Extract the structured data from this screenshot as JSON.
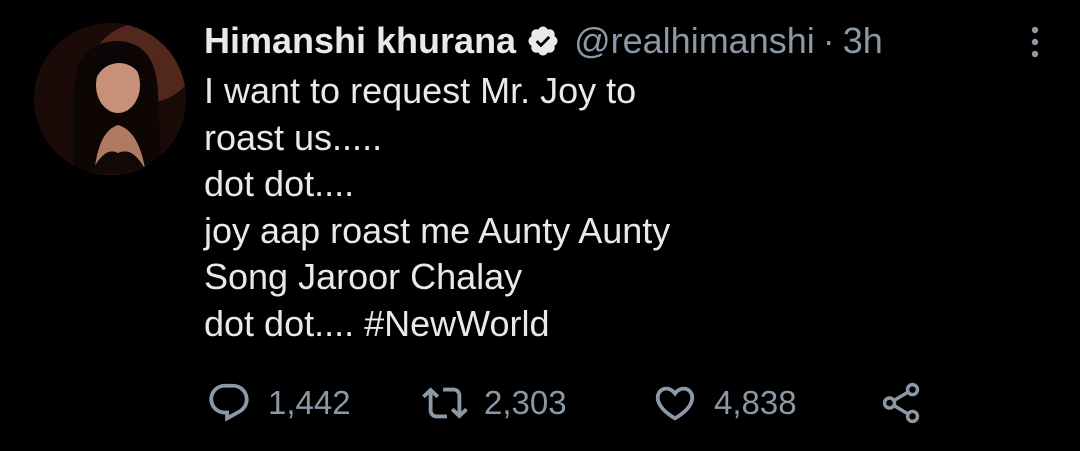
{
  "tweet": {
    "author": {
      "name": "Himanshi khurana",
      "handle": "@realhimanshi",
      "verified": true
    },
    "separator": "·",
    "time": "3h",
    "lines": [
      "I want to request Mr. Joy to",
      "roast us.....",
      "dot dot....",
      "joy aap roast me Aunty Aunty",
      "Song Jaroor Chalay"
    ],
    "last_line_prefix": "dot dot....",
    "hashtag": "#NewWorld",
    "stats": {
      "replies": "1,442",
      "retweets": "2,303",
      "likes": "4,838"
    },
    "icons": {
      "reply": "reply-icon",
      "retweet": "retweet-icon",
      "like": "heart-icon",
      "share": "share-icon",
      "more": "more-options-icon",
      "verified": "verified-badge-icon"
    },
    "colors": {
      "background": "#000000",
      "text": "#e7e9ea",
      "secondary": "#8b98a5"
    }
  }
}
